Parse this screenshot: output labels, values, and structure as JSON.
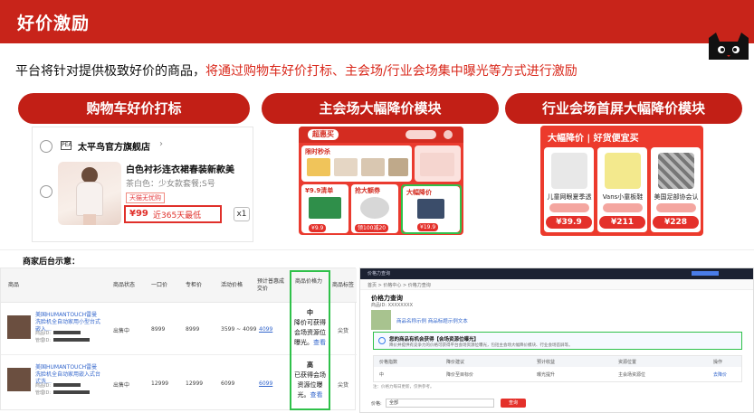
{
  "header": {
    "title": "好价激励",
    "logo": "tmall-cat-logo"
  },
  "subtitle": {
    "prefix": "平台将针对提供极致好价的商品，",
    "highlight": "将通过购物车好价打标、主会场/行业会场集中曝光等方式进行激励"
  },
  "colors": {
    "brand_red": "#c8241a",
    "highlight_green": "#2fc14a",
    "link_blue": "#3366cc"
  },
  "panels": {
    "cart": {
      "title": "购物车好价打标",
      "shop_name": "太平鸟官方旗舰店",
      "shop_logo": "PEA",
      "product_name": "白色衬衫连衣裙春装新款美",
      "sku": "茶白色：少女款套餐;S号",
      "badge": "天猫无忧购",
      "price": "¥99",
      "low_tag": "近365天最低",
      "qty": "x1"
    },
    "main_venue": {
      "title": "主会场大幅降价模块",
      "banner": "超惠买",
      "boxes": [
        {
          "label": "限时秒杀",
          "price": ""
        },
        {
          "label": "¥9.9清单",
          "price": "¥9.9"
        },
        {
          "label": "抢大额券",
          "price": "领100减20"
        },
        {
          "label": "大幅降价",
          "price": "¥19.9"
        }
      ]
    },
    "industry_venue": {
      "title": "行业会场首屏大幅降价模块",
      "heading": "大幅降价 | 好货便宜买",
      "items": [
        {
          "name": "儿童网眼夏季透",
          "price": "¥39.9"
        },
        {
          "name": "Vans小童板鞋",
          "price": "¥211"
        },
        {
          "name": "美国足部协会认",
          "price": "¥228"
        }
      ]
    }
  },
  "backend": {
    "label": "商家后台示意：",
    "table": {
      "headers": [
        "商品",
        "商品状态",
        "一口价",
        "专柜价",
        "活动价格",
        "预计普惠成交价",
        "商品价格力",
        "商品标签"
      ],
      "rows": [
        {
          "name": "美国HUMANTOUCH雷曼洗脸机全自动家用小型台式嵌入…",
          "id_label": "商品ID:",
          "code_label": "管理ID:",
          "status": "出售中",
          "price": "8999",
          "counter": "8999",
          "activity": "3599 ~ 4099",
          "est": "4099",
          "capacity": [
            "中",
            "降价可获得",
            "会场资源位",
            "曝光。"
          ],
          "view": "查看",
          "tag": "尖货"
        },
        {
          "name": "美国HUMANTOUCH雷曼洗脸机全自动家用嵌入式台式洗…",
          "id_label": "商品ID:",
          "code_label": "管理ID:",
          "status": "出售中",
          "price": "12999",
          "counter": "12999",
          "activity": "6099",
          "est": "6099",
          "capacity": [
            "高",
            "已获得会场",
            "资源位曝",
            "光。"
          ],
          "view": "查看",
          "tag": "尖货"
        }
      ]
    },
    "screen": {
      "topbar": "价格力查询",
      "nav": "首页 > 价格中心 > 价格力查询",
      "section": "价格力查询",
      "section_sub": "商品ID: XXXXXXXX",
      "product_text": "商品名称示例 商品标题示例文本",
      "notice_title": "您的商品有机会获得【会场资源位曝光】",
      "notice_body": "降价并提供有竞争力的价格可获得平台会场资源位曝光，包括主会场大幅降价模块、行业会场首屏等。",
      "grid_headers": [
        "价格指数",
        "降价建议",
        "预计收益",
        "资源位置",
        "操作"
      ],
      "grid_values": [
        "中",
        "降价至目标价",
        "曝光提升",
        "主会场资源位",
        "去降价"
      ],
      "footer_note": "注：价格力每日更新，仅供参考。",
      "select_label": "价格:",
      "select_value": "全部",
      "button": "查询"
    }
  }
}
